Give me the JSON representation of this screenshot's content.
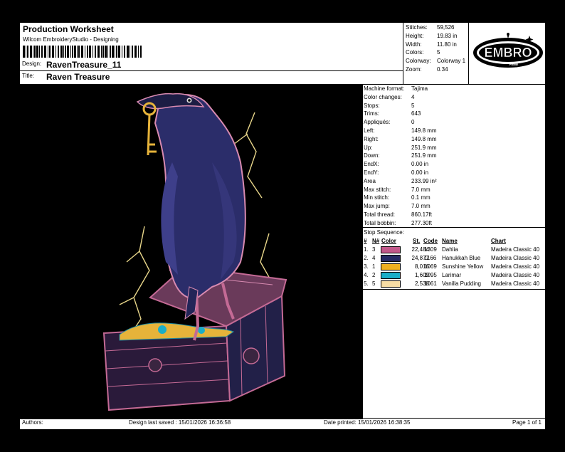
{
  "header": {
    "title": "Production Worksheet",
    "software": "Wilcom EmbroideryStudio - Designing",
    "design_label": "Design:",
    "design_value": "RavenTreasure_11",
    "title_label": "Title:",
    "title_value": "Raven Treasure"
  },
  "stats_top": [
    {
      "k": "Stitches:",
      "v": "59,526"
    },
    {
      "k": "Height:",
      "v": "19.83 in"
    },
    {
      "k": "Width:",
      "v": "11.80 in"
    },
    {
      "k": "Colors:",
      "v": "5"
    },
    {
      "k": "Colorway:",
      "v": "Colorway 1"
    },
    {
      "k": "Zoom:",
      "v": "0.34"
    }
  ],
  "logo": {
    "main": "EMBRO",
    "sub": "PRIME"
  },
  "machine": [
    {
      "k": "Machine format:",
      "v": "Tajima"
    },
    {
      "k": "Color changes:",
      "v": "4"
    },
    {
      "k": "Stops:",
      "v": "5"
    },
    {
      "k": "Trims:",
      "v": "643"
    },
    {
      "k": "Appliqués:",
      "v": "0"
    },
    {
      "k": "Left:",
      "v": "149.8 mm"
    },
    {
      "k": "Right:",
      "v": "149.8 mm"
    },
    {
      "k": "Up:",
      "v": "251.9 mm"
    },
    {
      "k": "Down:",
      "v": "251.9 mm"
    },
    {
      "k": "EndX:",
      "v": "0.00 in"
    },
    {
      "k": "EndY:",
      "v": "0.00 in"
    },
    {
      "k": "Area",
      "v": "233.99 in²"
    },
    {
      "k": "Max stitch:",
      "v": "7.0 mm"
    },
    {
      "k": "Min stitch:",
      "v": "0.1 mm"
    },
    {
      "k": "Max jump:",
      "v": "7.0 mm"
    },
    {
      "k": "Total thread:",
      "v": "860.17ft"
    },
    {
      "k": "Total bobbin:",
      "v": "277.30ft"
    }
  ],
  "stop_sequence": {
    "title": "Stop Sequence:",
    "headers": {
      "num": "#",
      "n": "N#",
      "color": "Color",
      "st": "St.",
      "code": "Code",
      "name": "Name",
      "chart": "Chart"
    },
    "rows": [
      {
        "num": "1.",
        "n": "3",
        "color": "#c2588a",
        "st": "22,484",
        "code": "1309",
        "name": "Dahlia",
        "chart": "Madeira Classic 40"
      },
      {
        "num": "2.",
        "n": "4",
        "color": "#262a64",
        "st": "24,877",
        "code": "1166",
        "name": "Hanukkah Blue",
        "chart": "Madeira Classic 40"
      },
      {
        "num": "3.",
        "n": "1",
        "color": "#f0b020",
        "st": "8,016",
        "code": "1069",
        "name": "Sunshine Yellow",
        "chart": "Madeira Classic 40"
      },
      {
        "num": "4.",
        "n": "2",
        "color": "#1aaec8",
        "st": "1,609",
        "code": "1095",
        "name": "Larimar",
        "chart": "Madeira Classic 40"
      },
      {
        "num": "5.",
        "n": "5",
        "color": "#f6dca4",
        "st": "2,538",
        "code": "1061",
        "name": "Vanilla Pudding",
        "chart": "Madeira Classic 40"
      }
    ]
  },
  "footer": {
    "authors": "Authors:",
    "saved": "Design last saved : 15/01/2026 16:36:58",
    "printed": "Date printed: 15/01/2026 16:38:35",
    "page": "Page 1 of 1"
  }
}
